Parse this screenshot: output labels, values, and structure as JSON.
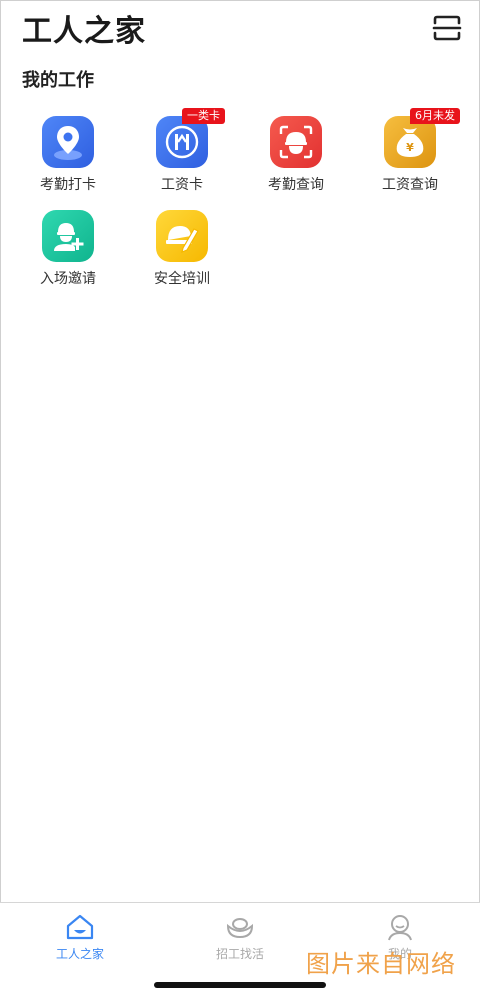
{
  "header": {
    "title": "工人之家"
  },
  "section": {
    "title": "我的工作"
  },
  "tiles": [
    {
      "label": "考勤打卡",
      "icon": "location-pin-icon",
      "color": "#3d73f0"
    },
    {
      "label": "工资卡",
      "icon": "salary-card-icon",
      "color": "#3d73f0",
      "badge": "一类卡"
    },
    {
      "label": "考勤查询",
      "icon": "face-scan-icon",
      "color": "#ef4040"
    },
    {
      "label": "工资查询",
      "icon": "money-bag-icon",
      "color": "#f0a81e",
      "badge": "6月未发"
    },
    {
      "label": "入场邀请",
      "icon": "worker-add-icon",
      "color": "#18c6a0"
    },
    {
      "label": "安全培训",
      "icon": "helmet-pencil-icon",
      "color": "#ffcc1c"
    }
  ],
  "tabbar": {
    "tabs": [
      {
        "label": "工人之家",
        "icon": "house-icon",
        "active": true
      },
      {
        "label": "招工找活",
        "icon": "ingot-icon",
        "active": false
      },
      {
        "label": "我的",
        "icon": "profile-icon",
        "active": false
      }
    ],
    "active_color": "#3a86f2",
    "inactive_color": "#a8a8a8"
  },
  "watermark": "图片来自网络"
}
